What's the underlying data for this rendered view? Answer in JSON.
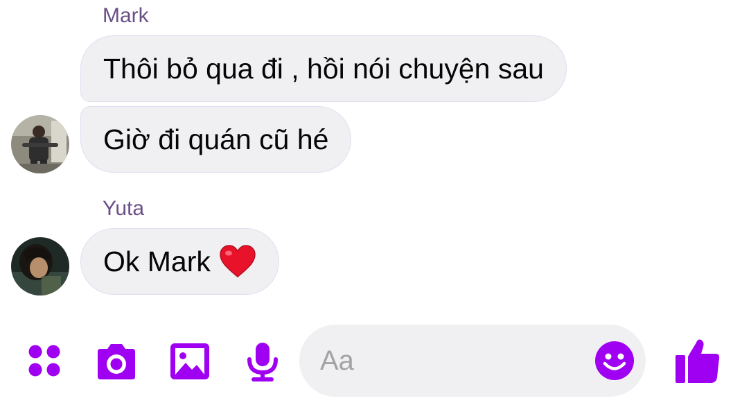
{
  "messages": [
    {
      "sender": "Mark",
      "bubbles": [
        "Thôi bỏ qua đi , hồi nói chuyện sau",
        "Giờ đi quán cũ hé"
      ]
    },
    {
      "sender": "Yuta",
      "bubbles": [
        "Ok Mark"
      ],
      "emoji": "heart-icon"
    }
  ],
  "composer": {
    "placeholder": "Aa",
    "icons": [
      "apps-icon",
      "camera-icon",
      "image-icon",
      "microphone-icon",
      "emoji-icon",
      "thumbs-up-icon"
    ]
  },
  "colors": {
    "accent": "#a000f2",
    "bubble_bg": "#f0f0f2",
    "sender_name": "#6a4f87",
    "heart": "#e8132b"
  }
}
